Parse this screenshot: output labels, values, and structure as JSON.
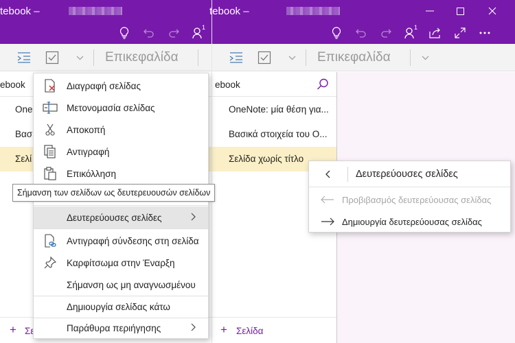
{
  "left_window": {
    "title": "tebook –",
    "section_label": "ebook",
    "heading_style": "Επικεφαλίδα",
    "pages": [
      "One",
      "Βασ",
      "Σελί"
    ],
    "add_page_label": "Σε"
  },
  "right_window": {
    "title": "tebook –",
    "notification_badge": "1",
    "section_label": "ebook",
    "heading_style": "Επικεφαλίδα",
    "pages": [
      "OneNote: μία θέση για...",
      "Βασικά στοιχεία του O...",
      "Σελίδα χωρίς τίτλο"
    ],
    "add_page_label": "Σελίδα"
  },
  "left_badge": "1",
  "context_menu": {
    "items": [
      "Διαγραφή σελίδας",
      "Μετονομασία σελίδας",
      "Αποκοπή",
      "Αντιγραφή",
      "Επικόλληση",
      "Δευτερεύουσες σελίδες",
      "Αντιγραφή σύνδεσης στη σελίδα",
      "Καρφίτσωμα στην Έναρξη",
      "Σήμανση ως μη αναγνωσμένου",
      "Δημιουργία σελίδας κάτω",
      "Παράθυρα περιήγησης"
    ]
  },
  "tooltip": "Σήμανση των σελίδων ως δευτερευουσών σελίδων",
  "flyout": {
    "title": "Δευτερεύουσες σελίδες",
    "promote": "Προβιβασμός δευτερεύουσας σελίδας",
    "demote": "Δημιουργία δευτερεύουσας σελίδας"
  },
  "colors": {
    "brand": "#7719aa",
    "selected_page": "#fbefc7",
    "canvas": "#fbf3fa"
  }
}
